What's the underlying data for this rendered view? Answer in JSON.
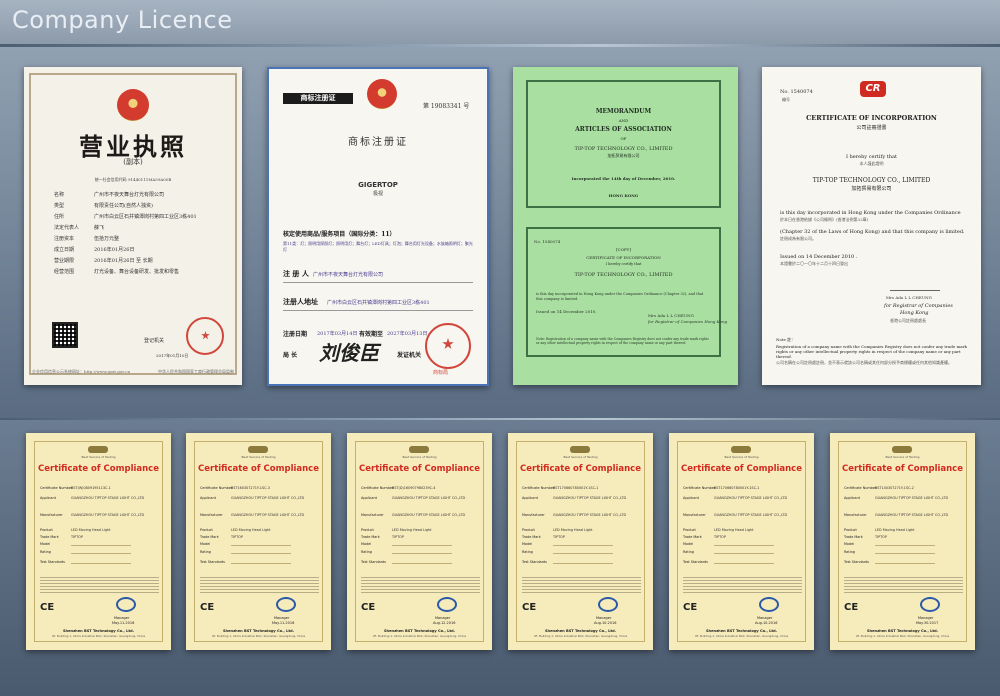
{
  "page": {
    "title": "Company Licence"
  },
  "business_licence": {
    "title": "营业执照",
    "subtitle": "(副本)",
    "serial": "统一社会信用代码 91440111MA59A00B",
    "rows": [
      {
        "k": "名称",
        "v": "广州市不夜天舞台灯光有限公司"
      },
      {
        "k": "类型",
        "v": "有限责任公司(自然人独资)"
      },
      {
        "k": "住所",
        "v": "广州市白云区石井镇潭岗村第四工业区3栋401"
      },
      {
        "k": "法定代表人",
        "v": "薛飞"
      },
      {
        "k": "注册资本",
        "v": "伍拾万元整"
      },
      {
        "k": "成立日期",
        "v": "2016年01月26日"
      },
      {
        "k": "营业期限",
        "v": "2016年01月26日 至 长期"
      },
      {
        "k": "经营范围",
        "v": "灯光设备、舞台设备研发、批发和零售"
      }
    ],
    "issuer": "登记机关",
    "date": "2017年01月10日",
    "footer_left": "企业信用信息公示系统网址：http://www.gsxt.gov.cn",
    "footer_right": "中华人民共和国国家工商行政管理总局监制"
  },
  "trademark": {
    "logo_text": "商标注册证",
    "number": "第 19083341 号",
    "title": "商标注册证",
    "mark": "GIGERTOP",
    "mark_cn": "极视",
    "goods_label": "核定使用商品/服务项目（国际分类：11）",
    "goods_value": "第11类：灯；照明用探照灯；照明用灯；舞台灯；LED灯具；灯泡；舞台用灯光设备；水族箱照明灯；聚光灯",
    "registrant_label": "注 册 人",
    "registrant_value": "广州市不夜天舞台灯光有限公司",
    "address_label": "注册人地址",
    "address_value": "广州市白云区石井镇潭岗村第四工业区3栋401",
    "date_label": "注册日期",
    "date_value": "2017年03月14日",
    "validity_label": "有效期至",
    "validity_value": "2027年03月13日",
    "director_label": "局 长",
    "director_signature": "刘俊臣",
    "office_label": "发证机关",
    "seal_text": "商标局"
  },
  "memorandum": {
    "line1": "MEMORANDUM",
    "line2": "AND",
    "line3": "ARTICLES OF ASSOCIATION",
    "line4": "OF",
    "company": "TIP-TOP TECHNOLOGY CO., LIMITED",
    "company_cn": "加拓贸易有限公司",
    "incorporated": "Incorporated the 14th day of December, 2010.",
    "place": "HONG KONG",
    "no": "No. 1540074",
    "copy": "[COPY]",
    "cert_title": "CERTIFICATE OF INCORPORATION",
    "certify": "I hereby certify that",
    "company2": "TIP-TOP TECHNOLOGY CO., LIMITED",
    "body": "is this day incorporated in Hong Kong under the Companies Ordinance (Chapter 32), and that this company is limited.",
    "issued": "Issued on 14 December 2010.",
    "registrar": "Mrs Ada L L CHEUNG",
    "registrar_title": "for Registrar of Companies Hong Kong",
    "note": "Note: Registration of a company name with the Companies Registry does not confer any trade mark rights or any other intellectual property rights in respect of the company name or any part thereof."
  },
  "incorporation": {
    "no": "No. 1540074",
    "no_cn": "编号",
    "logo": "CR",
    "title": "CERTIFICATE OF INCORPORATION",
    "title_cn": "公司註冊證書",
    "certify": "I hereby certify that",
    "certify_cn": "本人謹此證明",
    "company": "TIP-TOP TECHNOLOGY CO., LIMITED",
    "company_cn": "加拓貿易有限公司",
    "line1": "is this day incorporated in Hong Kong under the Companies Ordinance",
    "line1_cn": "於本日在香港依據《公司條例》(香港法例第32章)",
    "line2": "(Chapter 32 of the Laws of Hong Kong) and that this company is limited.",
    "line2_cn": "註冊成為有限公司。",
    "issued": "Issued on   14 December 2010 .",
    "issued_cn": "本證書於二〇一〇年十二月十四日發出",
    "signer": "Mrs Ada L L CHEUNG",
    "signer_title1": "for Registrar of Companies",
    "signer_title2": "Hong Kong",
    "signer_title_cn": "香港公司註冊處處長",
    "note_label": "Note 註：",
    "note": "Registration of a company name with the Companies Registry does not confer any trade mark rights or any other intellectual property rights in respect of the company name or any part thereof.",
    "note_cn": "公司名稱在公司註冊處註冊，並不表示就該公司名稱或其任何部分授予商標權或任何其他知識產權。"
  },
  "compliance_certificates": [
    {
      "title": "Certificate of Compliance",
      "tag": "Best Service of Testing",
      "number": "BST(W)0809195113C-1",
      "date": "May.11.2016"
    },
    {
      "title": "Certificate of Compliance",
      "tag": "Best Service of Testing",
      "number": "BST160307271Y-1SC-3",
      "date": "May.11.2016"
    },
    {
      "title": "Certificate of Compliance",
      "tag": "Best Service of Testing",
      "number": "BST(D)160907980239C-4",
      "date": "Aug.12.2016"
    },
    {
      "title": "Certificate of Compliance",
      "tag": "Best Service of Testing",
      "number": "BST170660780001Y-1SC-1",
      "date": "Aug.10.2016"
    },
    {
      "title": "Certificate of Compliance",
      "tag": "Best Service of Testing",
      "number": "BST170660780001Y-1SC-1",
      "date": "Aug.10.2016"
    },
    {
      "title": "Certificate of Compliance",
      "tag": "Best Service of Testing",
      "number": "BST140307271Y-1SC-2",
      "date": "May.30.2017"
    }
  ],
  "compliance_common": {
    "f_number": "Certificate Number",
    "f_applicant": "Applicant",
    "applicant": "GUANGZHOU TIPTOP STAGE LIGHT CO.,LTD",
    "f_manufacturer": "Manufacturer",
    "f_product": "Product",
    "product": "LED Moving Head Light",
    "f_trade": "Trade Mark",
    "trade": "TIPTOP",
    "f_model": "Model",
    "f_rating": "Rating",
    "f_test": "Test Standards",
    "ce": "CE",
    "manager": "Manager",
    "org": "Shenzhen BST Technology Co., Ltd.",
    "addr": "4F, Building 1, Xinhe Industrial Park, Shenzhen, Guangdong, China"
  }
}
